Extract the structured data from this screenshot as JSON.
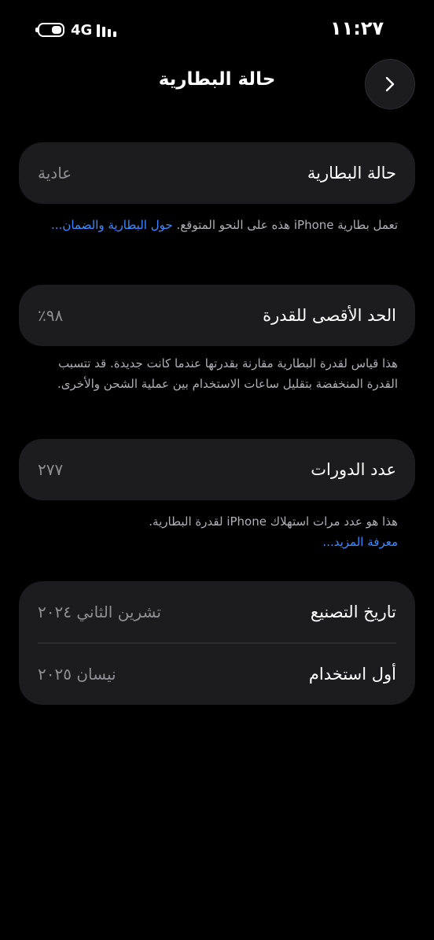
{
  "status_bar": {
    "time": "١١:٢٧",
    "network": "4G",
    "battery_level": 0.45
  },
  "header": {
    "title": "حالة البطارية",
    "back_icon": "chevron-right-icon"
  },
  "sections": {
    "health": {
      "label": "حالة البطارية",
      "value": "عادية",
      "footnote": "تعمل بطارية iPhone هذه على النحو المتوقع.",
      "link": "حول البطارية والضمان..."
    },
    "capacity": {
      "label": "الحد الأقصى للقدرة",
      "value": "٩٨٪",
      "footnote": "هذا قياس لقدرة البطارية مقارنة بقدرتها عندما كانت جديدة. قد تتسبب القدرة المنخفضة بتقليل ساعات الاستخدام بين عملية الشحن والأخرى."
    },
    "cycles": {
      "label": "عدد الدورات",
      "value": "٢٧٧",
      "footnote": "هذا هو عدد مرات استهلاك iPhone لقدرة البطارية.",
      "link": "معرفة المزيد..."
    },
    "dates": {
      "manufacture_label": "تاريخ التصنيع",
      "manufacture_value": "تشرين الثاني ٢٠٢٤",
      "first_use_label": "أول استخدام",
      "first_use_value": "نيسان ٢٠٢٥"
    }
  },
  "colors": {
    "background": "#000000",
    "card": "#1c1c1e",
    "link": "#3d8bff",
    "secondary_text": "#8e8e93"
  }
}
